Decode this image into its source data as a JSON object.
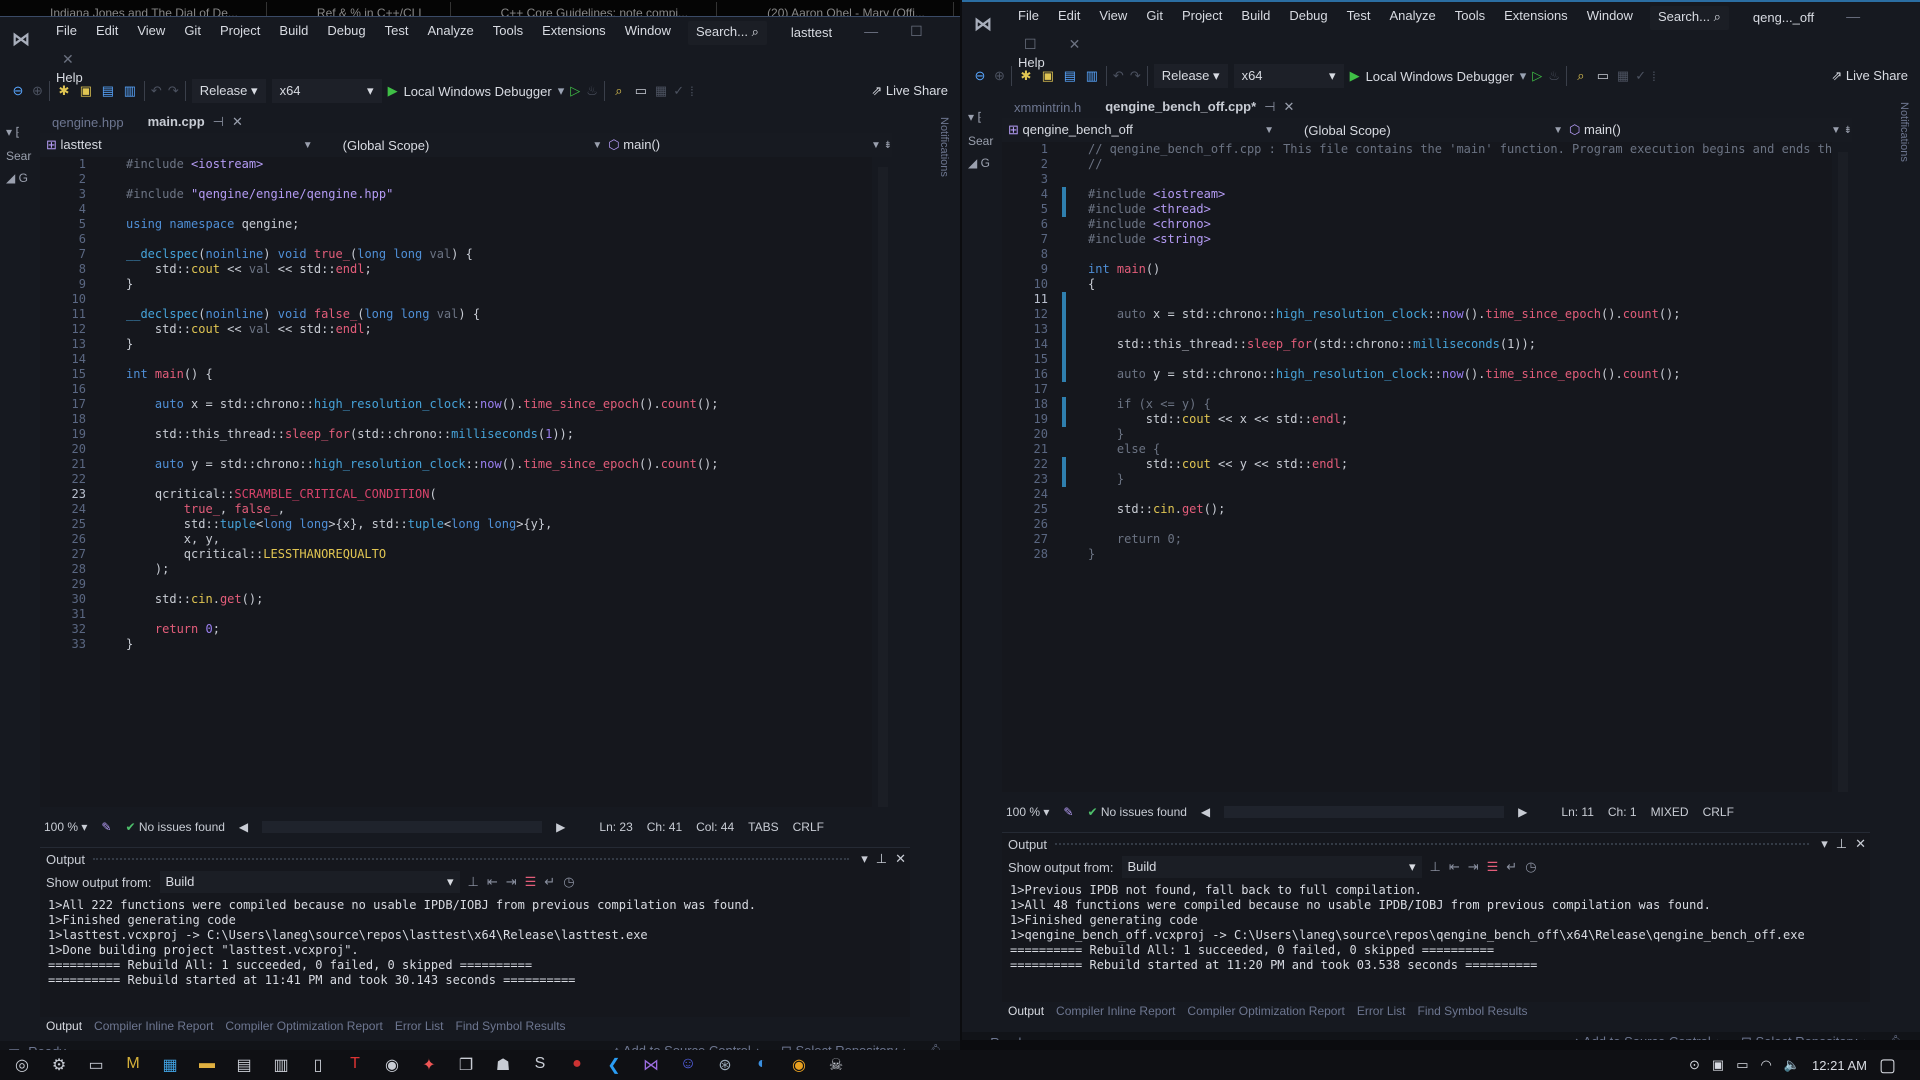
{
  "browser_tabs": [
    "Indiana Jones and The Dial of De...",
    "Ref & % in C++/CLI",
    "C++ Core Guidelines: note compi...",
    "(20) Aaron Ohel - Mary (Offi..."
  ],
  "left": {
    "menu": [
      "File",
      "Edit",
      "View",
      "Git",
      "Project",
      "Build",
      "Debug",
      "Test",
      "Analyze",
      "Tools",
      "Extensions",
      "Window"
    ],
    "menu_help": "Help",
    "search": "Search...",
    "title": "lasttest",
    "toolbar": {
      "config": "Release",
      "platform": "x64",
      "debugger": "Local Windows Debugger",
      "live_share": "Live Share"
    },
    "tabs": [
      {
        "label": "qengine.hpp",
        "active": false
      },
      {
        "label": "main.cpp",
        "active": true
      }
    ],
    "nav": {
      "project": "lasttest",
      "scope": "(Global Scope)",
      "member": "main()"
    },
    "current_line": 23,
    "code": [
      [
        [
          "pp",
          "#include "
        ],
        [
          "inc",
          "<iostream>"
        ]
      ],
      [],
      [
        [
          "pp",
          "#include "
        ],
        [
          "str",
          "\"qengine/engine/qengine.hpp\""
        ]
      ],
      [],
      [
        [
          "kw",
          "using "
        ],
        [
          "kw",
          "namespace "
        ],
        [
          "plain",
          "qengine;"
        ]
      ],
      [],
      [
        [
          "ty",
          "__declspec"
        ],
        [
          "plain",
          "("
        ],
        [
          "kw",
          "noinline"
        ],
        [
          "plain",
          ") "
        ],
        [
          "kw",
          "void "
        ],
        [
          "fn",
          "true_"
        ],
        [
          "plain",
          "("
        ],
        [
          "kw",
          "long long "
        ],
        [
          "dim",
          "val"
        ],
        [
          "plain",
          ") {"
        ]
      ],
      [
        [
          "plain",
          "    std::"
        ],
        [
          "mem",
          "cout"
        ],
        [
          "plain",
          " << "
        ],
        [
          "dim",
          "val"
        ],
        [
          "plain",
          " << std::"
        ],
        [
          "fn",
          "endl"
        ],
        [
          "plain",
          ";"
        ]
      ],
      [
        [
          "plain",
          "}"
        ]
      ],
      [],
      [
        [
          "ty",
          "__declspec"
        ],
        [
          "plain",
          "("
        ],
        [
          "kw",
          "noinline"
        ],
        [
          "plain",
          ") "
        ],
        [
          "kw",
          "void "
        ],
        [
          "fn",
          "false_"
        ],
        [
          "plain",
          "("
        ],
        [
          "kw",
          "long long "
        ],
        [
          "dim",
          "val"
        ],
        [
          "plain",
          ") {"
        ]
      ],
      [
        [
          "plain",
          "    std::"
        ],
        [
          "mem",
          "cout"
        ],
        [
          "plain",
          " << "
        ],
        [
          "dim",
          "val"
        ],
        [
          "plain",
          " << std::"
        ],
        [
          "fn",
          "endl"
        ],
        [
          "plain",
          ";"
        ]
      ],
      [
        [
          "plain",
          "}"
        ]
      ],
      [],
      [
        [
          "kw",
          "int "
        ],
        [
          "fn",
          "main"
        ],
        [
          "plain",
          "() {"
        ]
      ],
      [],
      [
        [
          "kw",
          "    auto "
        ],
        [
          "plain",
          "x = std::chrono::"
        ],
        [
          "ty",
          "high_resolution_clock"
        ],
        [
          "plain",
          "::"
        ],
        [
          "num",
          "now"
        ],
        [
          "plain",
          "()."
        ],
        [
          "fn",
          "time_since_epoch"
        ],
        [
          "plain",
          "()."
        ],
        [
          "fn",
          "count"
        ],
        [
          "plain",
          "();"
        ]
      ],
      [],
      [
        [
          "plain",
          "    std::this_thread::"
        ],
        [
          "fn",
          "sleep_for"
        ],
        [
          "plain",
          "(std::chrono::"
        ],
        [
          "ty",
          "milliseconds"
        ],
        [
          "plain",
          "("
        ],
        [
          "num",
          "1"
        ],
        [
          "plain",
          "));"
        ]
      ],
      [],
      [
        [
          "kw",
          "    auto "
        ],
        [
          "plain",
          "y = std::chrono::"
        ],
        [
          "ty",
          "high_resolution_clock"
        ],
        [
          "plain",
          "::"
        ],
        [
          "num",
          "now"
        ],
        [
          "plain",
          "()."
        ],
        [
          "fn",
          "time_since_epoch"
        ],
        [
          "plain",
          "()."
        ],
        [
          "fn",
          "count"
        ],
        [
          "plain",
          "();"
        ]
      ],
      [],
      [
        [
          "plain",
          "    qcritical::"
        ],
        [
          "mac",
          "SCRAMBLE_CRITICAL_CONDITION"
        ],
        [
          "plain",
          "("
        ]
      ],
      [
        [
          "fn",
          "        true_"
        ],
        [
          "plain",
          ", "
        ],
        [
          "fn",
          "false_"
        ],
        [
          "plain",
          ","
        ]
      ],
      [
        [
          "plain",
          "        std::"
        ],
        [
          "ty",
          "tuple"
        ],
        [
          "plain",
          "<"
        ],
        [
          "kw",
          "long long"
        ],
        [
          "plain",
          ">{x}, std::"
        ],
        [
          "ty",
          "tuple"
        ],
        [
          "plain",
          "<"
        ],
        [
          "kw",
          "long long"
        ],
        [
          "plain",
          ">{y},"
        ]
      ],
      [
        [
          "plain",
          "        x, y,"
        ]
      ],
      [
        [
          "plain",
          "        qcritical::"
        ],
        [
          "mem",
          "LESSTHANOREQUALTO"
        ]
      ],
      [
        [
          "plain",
          "    );"
        ]
      ],
      [],
      [
        [
          "plain",
          "    std::"
        ],
        [
          "mem",
          "cin"
        ],
        [
          "plain",
          "."
        ],
        [
          "fn",
          "get"
        ],
        [
          "plain",
          "();"
        ]
      ],
      [],
      [
        [
          "fn",
          "    return "
        ],
        [
          "num",
          "0"
        ],
        [
          "plain",
          ";"
        ]
      ],
      [
        [
          "plain",
          "}"
        ]
      ]
    ],
    "status": {
      "zoom": "100 %",
      "issues": "No issues found",
      "ln": "Ln: 23",
      "ch": "Ch: 41",
      "col": "Col: 44",
      "indent": "TABS",
      "eol": "CRLF"
    },
    "output": {
      "title": "Output",
      "show_from_label": "Show output from:",
      "show_from_value": "Build",
      "lines": [
        "1>All 222 functions were compiled because no usable IPDB/IOBJ from previous compilation was found.",
        "1>Finished generating code",
        "1>lasttest.vcxproj -> C:\\Users\\laneg\\source\\repos\\lasttest\\x64\\Release\\lasttest.exe",
        "1>Done building project \"lasttest.vcxproj\".",
        "========== Rebuild All: 1 succeeded, 0 failed, 0 skipped ==========",
        "========== Rebuild started at 11:41 PM and took 30.143 seconds =========="
      ]
    },
    "bottom_tabs": [
      "Output",
      "Compiler Inline Report",
      "Compiler Optimization Report",
      "Error List",
      "Find Symbol Results"
    ],
    "statusbar": {
      "ready": "Ready",
      "source_control": "Add to Source Control",
      "repo": "Select Repository"
    },
    "side_labels": {
      "notifications": "Notifications",
      "search": "Sear"
    }
  },
  "right": {
    "menu": [
      "File",
      "Edit",
      "View",
      "Git",
      "Project",
      "Build",
      "Debug",
      "Test",
      "Analyze",
      "Tools",
      "Extensions",
      "Window"
    ],
    "menu_help": "Help",
    "search": "Search...",
    "title": "qeng..._off",
    "toolbar": {
      "config": "Release",
      "platform": "x64",
      "debugger": "Local Windows Debugger",
      "live_share": "Live Share"
    },
    "tabs": [
      {
        "label": "xmmintrin.h",
        "active": false
      },
      {
        "label": "qengine_bench_off.cpp*",
        "active": true
      }
    ],
    "nav": {
      "project": "qengine_bench_off",
      "scope": "(Global Scope)",
      "member": "main()"
    },
    "current_line": 11,
    "code": [
      [
        [
          "cm",
          "// qengine_bench_off.cpp : This file contains the 'main' function. Program execution begins and ends there."
        ]
      ],
      [
        [
          "cm",
          "//"
        ]
      ],
      [],
      [
        [
          "pp",
          "#include "
        ],
        [
          "inc",
          "<iostream>"
        ]
      ],
      [
        [
          "pp",
          "#include "
        ],
        [
          "inc",
          "<thread>"
        ]
      ],
      [
        [
          "pp",
          "#include "
        ],
        [
          "inc",
          "<chrono>"
        ]
      ],
      [
        [
          "pp",
          "#include "
        ],
        [
          "inc",
          "<string>"
        ]
      ],
      [],
      [
        [
          "kw",
          "int "
        ],
        [
          "fn",
          "main"
        ],
        [
          "plain",
          "()"
        ]
      ],
      [
        [
          "plain",
          "{"
        ]
      ],
      [],
      [
        [
          "dim",
          "    auto "
        ],
        [
          "plain",
          "x = std::chrono::"
        ],
        [
          "ty",
          "high_resolution_clock"
        ],
        [
          "plain",
          "::"
        ],
        [
          "num",
          "now"
        ],
        [
          "plain",
          "()."
        ],
        [
          "fn",
          "time_since_epoch"
        ],
        [
          "plain",
          "()."
        ],
        [
          "fn",
          "count"
        ],
        [
          "plain",
          "();"
        ]
      ],
      [],
      [
        [
          "plain",
          "    std::this_thread::"
        ],
        [
          "fn",
          "sleep_for"
        ],
        [
          "plain",
          "(std::chrono::"
        ],
        [
          "ty",
          "milliseconds"
        ],
        [
          "plain",
          "(1));"
        ]
      ],
      [],
      [
        [
          "dim",
          "    auto "
        ],
        [
          "plain",
          "y = std::chrono::"
        ],
        [
          "ty",
          "high_resolution_clock"
        ],
        [
          "plain",
          "::"
        ],
        [
          "num",
          "now"
        ],
        [
          "plain",
          "()."
        ],
        [
          "fn",
          "time_since_epoch"
        ],
        [
          "plain",
          "()."
        ],
        [
          "fn",
          "count"
        ],
        [
          "plain",
          "();"
        ]
      ],
      [],
      [
        [
          "dim",
          "    if (x <= y) {"
        ]
      ],
      [
        [
          "plain",
          "        std::"
        ],
        [
          "mem",
          "cout"
        ],
        [
          "plain",
          " << x << std::"
        ],
        [
          "fn",
          "endl"
        ],
        [
          "plain",
          ";"
        ]
      ],
      [
        [
          "dim",
          "    }"
        ]
      ],
      [
        [
          "dim",
          "    else {"
        ]
      ],
      [
        [
          "plain",
          "        std::"
        ],
        [
          "mem",
          "cout"
        ],
        [
          "plain",
          " << y << std::"
        ],
        [
          "fn",
          "endl"
        ],
        [
          "plain",
          ";"
        ]
      ],
      [
        [
          "dim",
          "    }"
        ]
      ],
      [],
      [
        [
          "plain",
          "    std::"
        ],
        [
          "mem",
          "cin"
        ],
        [
          "plain",
          "."
        ],
        [
          "fn",
          "get"
        ],
        [
          "plain",
          "();"
        ]
      ],
      [],
      [
        [
          "dim",
          "    return 0;"
        ]
      ],
      [
        [
          "dim",
          "}"
        ]
      ]
    ],
    "status": {
      "zoom": "100 %",
      "issues": "No issues found",
      "ln": "Ln: 11",
      "ch": "Ch: 1",
      "indent": "MIXED",
      "eol": "CRLF"
    },
    "output": {
      "title": "Output",
      "show_from_label": "Show output from:",
      "show_from_value": "Build",
      "lines": [
        "1>Previous IPDB not found, fall back to full compilation.",
        "1>All 48 functions were compiled because no usable IPDB/IOBJ from previous compilation was found.",
        "1>Finished generating code",
        "1>qengine_bench_off.vcxproj -> C:\\Users\\laneg\\source\\repos\\qengine_bench_off\\x64\\Release\\qengine_bench_off.exe",
        "========== Rebuild All: 1 succeeded, 0 failed, 0 skipped ==========",
        "========== Rebuild started at 11:20 PM and took 03.538 seconds =========="
      ]
    },
    "bottom_tabs": [
      "Output",
      "Compiler Inline Report",
      "Compiler Optimization Report",
      "Error List",
      "Find Symbol Results"
    ],
    "statusbar": {
      "ready": "Ready",
      "source_control": "Add to Source Control",
      "repo": "Select Repository"
    },
    "side_labels": {
      "notifications": "Notifications",
      "search": "Sear"
    }
  },
  "taskbar": {
    "apps": [
      "cortana-icon",
      "settings-icon",
      "terminal-icon",
      "app-m-icon",
      "store-icon",
      "file-explorer-icon",
      "monitor-icon",
      "calculator-icon",
      "notepad-icon",
      "app-t-icon",
      "app-icon",
      "app-fire-icon",
      "copy-icon",
      "app-person-icon",
      "app-s-icon",
      "app-red-icon",
      "vscode-icon",
      "visual-studio-icon",
      "discord-icon",
      "steam-icon",
      "firefox-icon",
      "chrome-icon",
      "app-ghost-icon"
    ],
    "clock": "12:21 AM"
  }
}
